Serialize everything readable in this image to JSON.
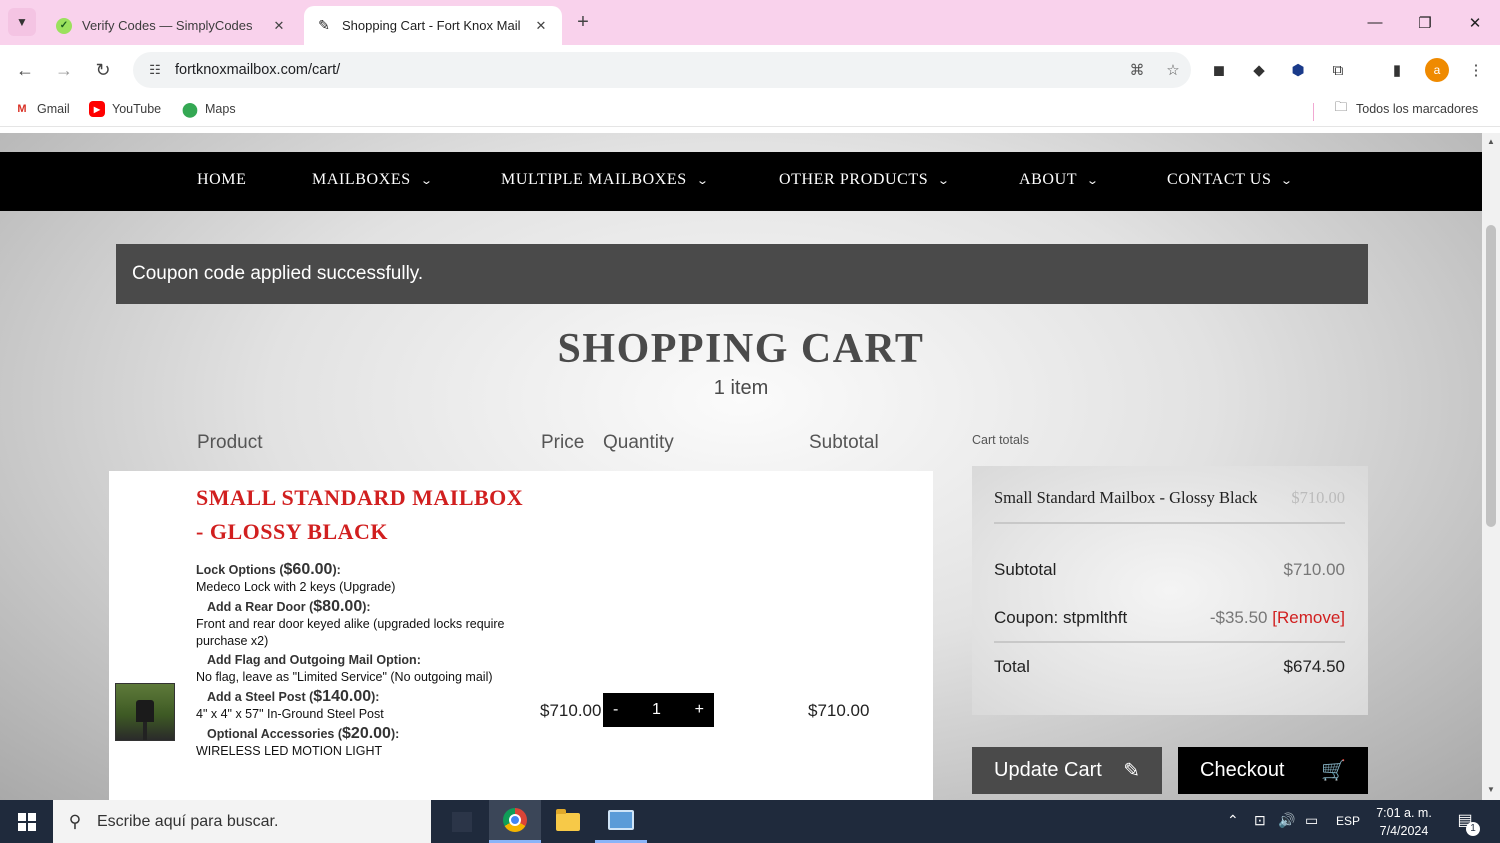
{
  "browser": {
    "tabs": [
      {
        "title": "Verify Codes — SimplyCodes",
        "active": false
      },
      {
        "title": "Shopping Cart - Fort Knox Mail",
        "active": true
      }
    ],
    "url": "fortknoxmailbox.com/cart/",
    "bookmarks": [
      "Gmail",
      "YouTube",
      "Maps"
    ],
    "all_bookmarks": "Todos los marcadores",
    "profile_initial": "a"
  },
  "site_nav": {
    "items": [
      "HOME",
      "MAILBOXES",
      "MULTIPLE MAILBOXES",
      "OTHER PRODUCTS",
      "ABOUT",
      "CONTACT US"
    ]
  },
  "notice": "Coupon code applied successfully.",
  "cart": {
    "title": "SHOPPING CART",
    "count": "1 item",
    "headers": {
      "product": "Product",
      "price": "Price",
      "quantity": "Quantity",
      "subtotal": "Subtotal"
    },
    "item": {
      "name": "SMALL STANDARD MAILBOX - GLOSSY BLACK",
      "options": [
        {
          "label": "Lock Options",
          "amount": "$60.00",
          "value": "Medeco Lock with 2 keys (Upgrade)"
        },
        {
          "label": "Add a Rear Door",
          "amount": "$80.00",
          "value": "Front and rear door keyed alike (upgraded locks require purchase x2)"
        },
        {
          "label": "Add Flag and Outgoing Mail Option:",
          "amount": "",
          "value": "No flag, leave as \"Limited Service\" (No outgoing mail)"
        },
        {
          "label": "Add a Steel Post",
          "amount": "$140.00",
          "value": "4\" x 4\" x 57\" In-Ground Steel Post"
        },
        {
          "label": "Optional Accessories",
          "amount": "$20.00",
          "value": "WIRELESS LED MOTION LIGHT"
        }
      ],
      "price": "$710.00",
      "quantity": "1",
      "qty_minus": "-",
      "qty_plus": "+",
      "subtotal": "$710.00"
    }
  },
  "totals": {
    "label": "Cart totals",
    "line_item_name": "Small Standard Mailbox - Glossy Black",
    "line_item_price": "$710.00",
    "subtotal_label": "Subtotal",
    "subtotal_value": "$710.00",
    "coupon_label": "Coupon: stpmlthft",
    "coupon_value": "-$35.50",
    "coupon_remove": "[Remove]",
    "total_label": "Total",
    "total_value": "$674.50"
  },
  "buttons": {
    "update": "Update Cart",
    "checkout": "Checkout"
  },
  "taskbar": {
    "search_placeholder": "Escribe aquí para buscar.",
    "language": "ESP",
    "time": "7:01 a. m.",
    "date": "7/4/2024",
    "notifications": "1"
  },
  "colors": {
    "accent_red": "#d11f1f",
    "nav_black": "#000000",
    "notice_gray": "#4a4a4a",
    "tab_strip": "#f9d2ec"
  }
}
